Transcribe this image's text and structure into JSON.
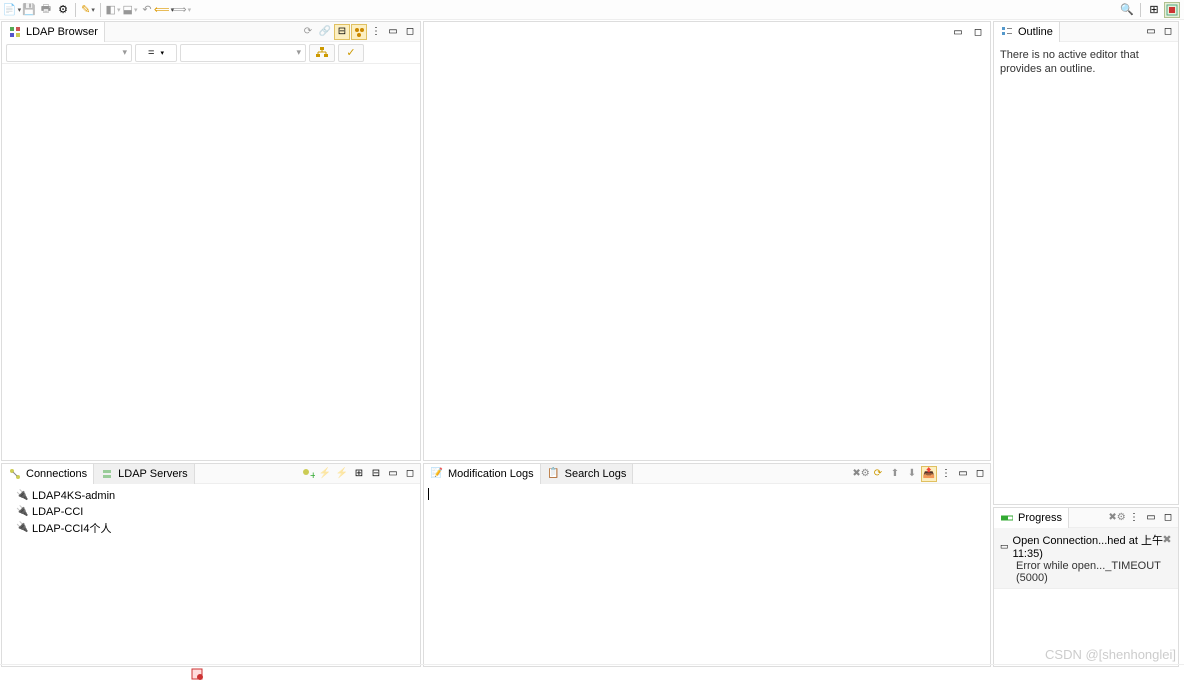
{
  "toolbar": {
    "new_icon": "new",
    "save_icon": "save",
    "print_icon": "print",
    "gear_icon": "gear",
    "wand_icon": "wand",
    "search_icon": "search",
    "perspective_icon": "persp",
    "ldap_persp_icon": "ldap"
  },
  "ldapBrowser": {
    "title": "LDAP Browser",
    "filter_op": "="
  },
  "connections": {
    "tabs": [
      "Connections",
      "LDAP Servers"
    ],
    "items": [
      {
        "label": "LDAP4KS-admin"
      },
      {
        "label": "LDAP-CCI"
      },
      {
        "label": "LDAP-CCI4个人"
      }
    ]
  },
  "outline": {
    "title": "Outline",
    "message": "There is no active editor that provides an outline."
  },
  "logs": {
    "tabs": [
      "Modification Logs",
      "Search Logs"
    ]
  },
  "progress": {
    "title": "Progress",
    "item": {
      "title": "Open Connection...hed at 上午 11:35)",
      "error": "Error while open..._TIMEOUT (5000)"
    }
  },
  "watermark": "CSDN @[shenhonglei]"
}
